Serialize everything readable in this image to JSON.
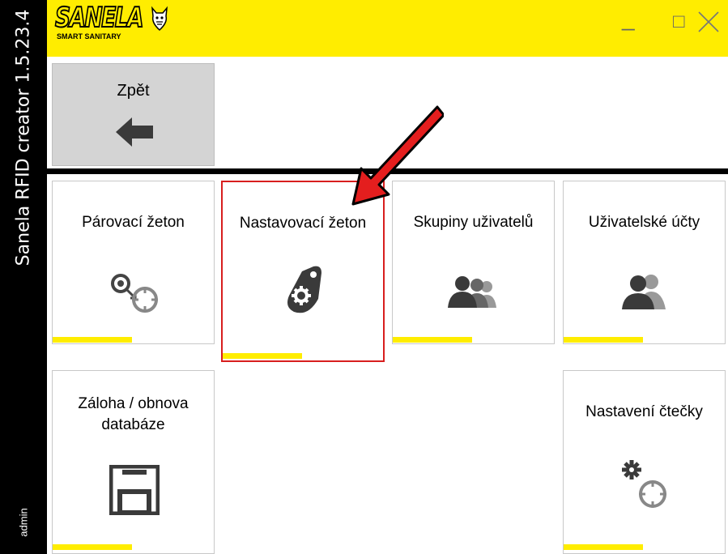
{
  "window": {
    "app_title": "Sanela RFID creator 1.5.23.4",
    "user": "admin",
    "brand": "SANELA",
    "brand_tagline": "SMART SANITARY",
    "minimize_glyph": "_",
    "maximize_glyph": "□",
    "close_glyph": "✕"
  },
  "colors": {
    "accent_yellow": "#ffed00",
    "sidebar_black": "#000000",
    "selection_red": "#d81e1e",
    "icon_gray": "#3a3a3a"
  },
  "back": {
    "label": "Zpět",
    "icon": "arrow-left-icon"
  },
  "tiles": [
    {
      "label": "Párovací žeton",
      "icon": "pairing-token-icon"
    },
    {
      "label": "Nastavovací žeton",
      "icon": "settings-token-icon",
      "selected": true
    },
    {
      "label": "Skupiny uživatelů",
      "icon": "user-groups-icon"
    },
    {
      "label": "Uživatelské účty",
      "icon": "user-accounts-icon"
    },
    {
      "label": "Záloha / obnova databáze",
      "icon": "floppy-disk-icon"
    },
    {
      "label": "Nastavení čtečky",
      "icon": "reader-settings-icon"
    }
  ]
}
